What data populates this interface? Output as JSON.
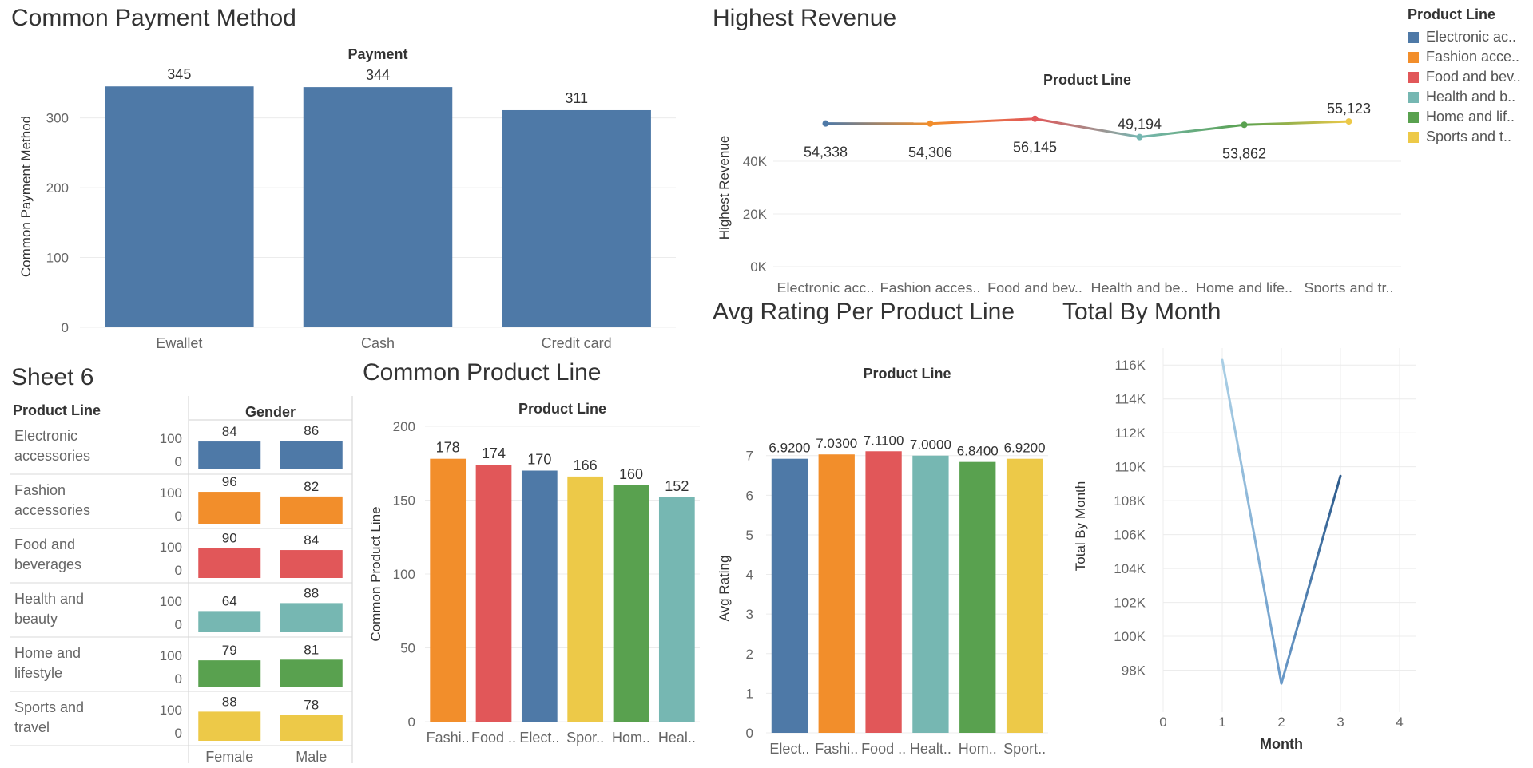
{
  "dashboard": {
    "titles": {
      "payment": "Common Payment Method",
      "revenue": "Highest Revenue",
      "sheet6": "Sheet 6",
      "product": "Common Product Line",
      "rating": "Avg Rating Per Product Line",
      "month": "Total By Month"
    },
    "legend": {
      "title": "Product Line",
      "items": [
        {
          "label": "Electronic ac..",
          "color": "#4e79a7"
        },
        {
          "label": "Fashion acce..",
          "color": "#f28e2b"
        },
        {
          "label": "Food and bev..",
          "color": "#e15759"
        },
        {
          "label": "Health and b..",
          "color": "#76b7b2"
        },
        {
          "label": "Home and lif..",
          "color": "#59a14f"
        },
        {
          "label": "Sports and t..",
          "color": "#edc948"
        }
      ]
    }
  },
  "chart_data": [
    {
      "id": "payment",
      "type": "bar",
      "title": "Common Payment Method",
      "header": "Payment",
      "ylabel": "Common Payment Method",
      "categories": [
        "Ewallet",
        "Cash",
        "Credit card"
      ],
      "values": [
        345,
        344,
        311
      ],
      "yticks": [
        0,
        100,
        200,
        300
      ],
      "ylim": [
        0,
        375
      ],
      "color": "#4e79a7",
      "grid": true
    },
    {
      "id": "revenue",
      "type": "line",
      "title": "Highest Revenue",
      "header": "Product Line",
      "ylabel": "Highest Revenue",
      "categories": [
        "Electronic acc..",
        "Fashion acces..",
        "Food and bev..",
        "Health and be..",
        "Home and life..",
        "Sports and tr.."
      ],
      "values": [
        54338,
        54306,
        56145,
        49194,
        53862,
        55123
      ],
      "labels": [
        "54,338",
        "54,306",
        "56,145",
        "49,194",
        "53,862",
        "55,123"
      ],
      "colors": [
        "#4e79a7",
        "#f28e2b",
        "#e15759",
        "#76b7b2",
        "#59a14f",
        "#edc948"
      ],
      "yticks": [
        0,
        20000,
        40000
      ],
      "ytick_labels": [
        "0K",
        "20K",
        "40K"
      ],
      "ylim": [
        0,
        60000
      ],
      "grid": true
    },
    {
      "id": "sheet6",
      "type": "bar",
      "title": "Sheet 6",
      "row_header": "Product Line",
      "col_header": "Gender",
      "rows": [
        "Electronic accessories",
        "Fashion accessories",
        "Food and beverages",
        "Health and beauty",
        "Home and lifestyle",
        "Sports and travel"
      ],
      "row_labels": [
        [
          "Electronic",
          "accessories"
        ],
        [
          "Fashion",
          "accessories"
        ],
        [
          "Food and",
          "beverages"
        ],
        [
          "Health and",
          "beauty"
        ],
        [
          "Home and",
          "lifestyle"
        ],
        [
          "Sports and",
          "travel"
        ]
      ],
      "columns": [
        "Female",
        "Male"
      ],
      "values": [
        [
          84,
          86
        ],
        [
          96,
          82
        ],
        [
          90,
          84
        ],
        [
          64,
          88
        ],
        [
          79,
          81
        ],
        [
          88,
          78
        ]
      ],
      "colors": [
        "#4e79a7",
        "#f28e2b",
        "#e15759",
        "#76b7b2",
        "#59a14f",
        "#edc948"
      ],
      "yticks": [
        0,
        100
      ],
      "ylim": [
        0,
        125
      ]
    },
    {
      "id": "product",
      "type": "bar",
      "title": "Common Product Line",
      "header": "Product Line",
      "ylabel": "Common Product Line",
      "categories": [
        "Fashi..",
        "Food ..",
        "Elect..",
        "Spor..",
        "Hom..",
        "Heal.."
      ],
      "values": [
        178,
        174,
        170,
        166,
        160,
        152
      ],
      "colors": [
        "#f28e2b",
        "#e15759",
        "#4e79a7",
        "#edc948",
        "#59a14f",
        "#76b7b2"
      ],
      "yticks": [
        0,
        50,
        100,
        150,
        200
      ],
      "ylim": [
        0,
        200
      ],
      "grid": true
    },
    {
      "id": "rating",
      "type": "bar",
      "title": "Avg Rating Per Product Line",
      "header": "Product Line",
      "ylabel": "Avg Rating",
      "categories": [
        "Elect..",
        "Fashi..",
        "Food ..",
        "Healt..",
        "Hom..",
        "Sport.."
      ],
      "values": [
        6.92,
        7.03,
        7.11,
        7.0,
        6.84,
        6.92
      ],
      "labels": [
        "6.9200",
        "7.0300",
        "7.1100",
        "7.0000",
        "6.8400",
        "6.9200"
      ],
      "colors": [
        "#4e79a7",
        "#f28e2b",
        "#e15759",
        "#76b7b2",
        "#59a14f",
        "#edc948"
      ],
      "yticks": [
        0,
        1,
        2,
        3,
        4,
        5,
        6,
        7
      ],
      "ylim": [
        0,
        7.7
      ],
      "grid": true
    },
    {
      "id": "month",
      "type": "line",
      "title": "Total By Month",
      "xlabel": "Month",
      "ylabel": "Total By Month",
      "x": [
        1,
        2,
        3
      ],
      "values": [
        116292,
        97219,
        109456
      ],
      "color_start": "#aacfe5",
      "color_mid": "#6a9ac9",
      "color_end": "#2d5b8c",
      "xticks": [
        0,
        1,
        2,
        3,
        4
      ],
      "xlim": [
        0,
        4
      ],
      "yticks": [
        98000,
        100000,
        102000,
        104000,
        106000,
        108000,
        110000,
        112000,
        114000,
        116000
      ],
      "ytick_labels": [
        "98K",
        "100K",
        "102K",
        "104K",
        "106K",
        "108K",
        "110K",
        "112K",
        "114K",
        "116K"
      ],
      "ylim": [
        96000,
        117000
      ],
      "grid": true
    }
  ]
}
